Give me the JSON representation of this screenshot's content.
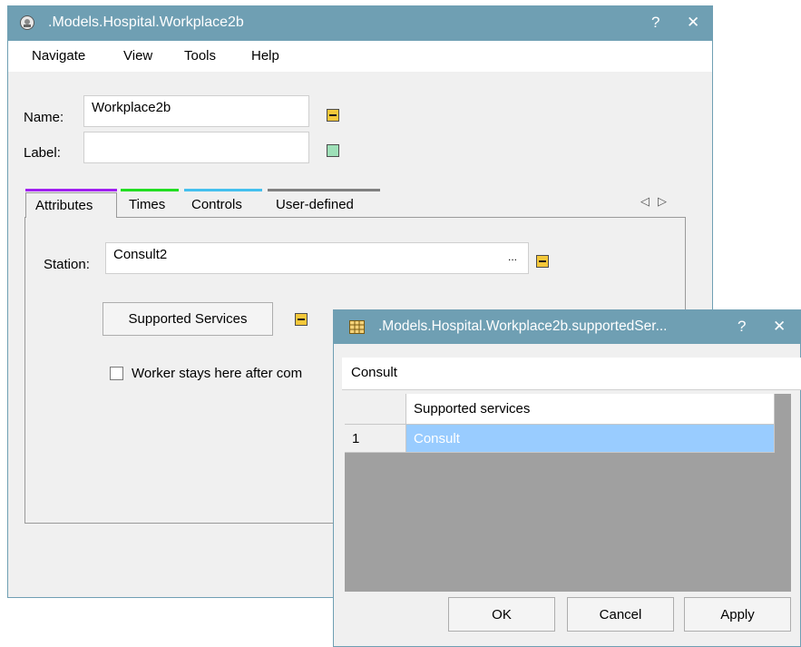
{
  "main_window": {
    "title": ".Models.Hospital.Workplace2b",
    "help_glyph": "?",
    "close_glyph": "✕",
    "menu": [
      "Navigate",
      "View",
      "Tools",
      "Help"
    ],
    "name_label": "Name:",
    "name_value": "Workplace2b",
    "label_label": "Label:",
    "label_value": "",
    "tabs": [
      {
        "label": "Attributes",
        "color": "#a020f0"
      },
      {
        "label": "Times",
        "color": "#22dd22"
      },
      {
        "label": "Controls",
        "color": "#44c0ee"
      },
      {
        "label": "User-defined",
        "color": "#808080"
      }
    ],
    "tab_scroll_left": "◁",
    "tab_scroll_right": "▷",
    "station_label": "Station:",
    "station_value": "Consult2",
    "station_browse": "...",
    "supported_services_button": "Supported Services",
    "worker_stays_label": "Worker stays here after com"
  },
  "dialog": {
    "title": ".Models.Hospital.Workplace2b.supportedSer...",
    "help_glyph": "?",
    "close_glyph": "✕",
    "header_value": "Consult",
    "table": {
      "columns": [
        "Supported services"
      ],
      "rows": [
        {
          "index": "1",
          "value": "Consult"
        }
      ]
    },
    "ok_button": "OK",
    "cancel_button": "Cancel",
    "apply_button": "Apply"
  },
  "colors": {
    "titlebar": "#6f9fb3",
    "selection": "#99ccff",
    "grid_background": "#a0a0a0"
  }
}
